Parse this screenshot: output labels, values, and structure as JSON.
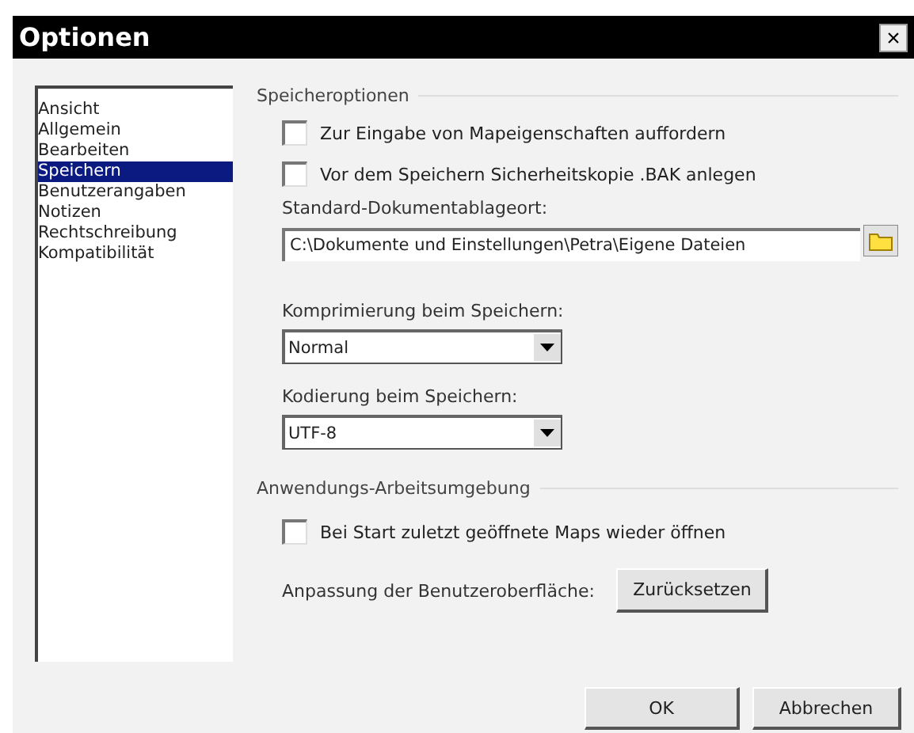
{
  "window": {
    "title": "Optionen",
    "close": "×"
  },
  "sidebar": {
    "items": [
      {
        "label": "Ansicht",
        "selected": false
      },
      {
        "label": "Allgemein",
        "selected": false
      },
      {
        "label": "Bearbeiten",
        "selected": false
      },
      {
        "label": "Speichern",
        "selected": true
      },
      {
        "label": "Benutzerangaben",
        "selected": false
      },
      {
        "label": "Notizen",
        "selected": false
      },
      {
        "label": "Rechtschreibung",
        "selected": false
      },
      {
        "label": "Kompatibilität",
        "selected": false
      }
    ]
  },
  "save_options": {
    "title": "Speicheroptionen",
    "checkboxes": [
      {
        "label": "Zur Eingabe von Mapeigenschaften auffordern",
        "checked": false
      },
      {
        "label": "Vor dem Speichern Sicherheitskopie .BAK anlegen",
        "checked": false
      }
    ],
    "location_label": "Standard-Dokumentablageort:",
    "location_value": "C:\\Dokumente und Einstellungen\\Petra\\Eigene Dateien",
    "compression_label": "Komprimierung beim Speichern:",
    "compression_value": "Normal",
    "encoding_label": "Kodierung beim Speichern:",
    "encoding_value": "UTF-8"
  },
  "workspace": {
    "title": "Anwendungs-Arbeitsumgebung",
    "checkboxes": [
      {
        "label": "Bei Start zuletzt geöffnete Maps wieder öffnen",
        "checked": false
      }
    ],
    "customize_label": "Anpassung der Benutzeroberfläche:",
    "reset_button": "Zurücksetzen"
  },
  "buttons": [
    "OK",
    "Abbrechen"
  ]
}
